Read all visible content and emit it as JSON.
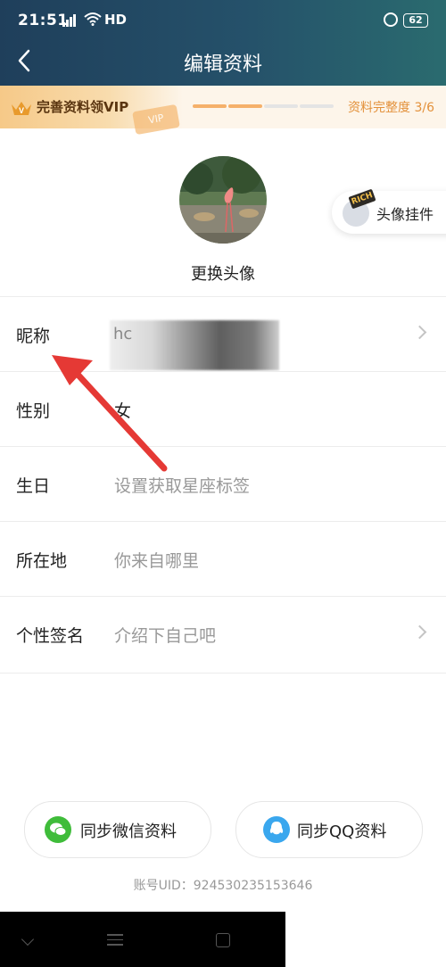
{
  "status_bar": {
    "time": "21:51",
    "network_label": "HD",
    "battery_level": "62"
  },
  "header": {
    "title": "编辑资料"
  },
  "vip_banner": {
    "label": "完善资料领VIP",
    "ticket_text": "VIP",
    "progress_text": "资料完整度 3/6",
    "completed_steps": 3,
    "total_steps": 6,
    "accent_color": "#f5b06a"
  },
  "profile": {
    "change_avatar_label": "更换头像",
    "pendant_label": "头像挂件",
    "pendant_badge": "RICH"
  },
  "fields": {
    "nickname": {
      "label": "昵称",
      "value": "hc"
    },
    "gender": {
      "label": "性别",
      "value": "女"
    },
    "birthday": {
      "label": "生日",
      "placeholder": "设置获取星座标签"
    },
    "location": {
      "label": "所在地",
      "placeholder": "你来自哪里"
    },
    "signature": {
      "label": "个性签名",
      "placeholder": "介绍下自己吧"
    }
  },
  "sync": {
    "wechat_label": "同步微信资料",
    "qq_label": "同步QQ资料",
    "wechat_color": "#3fbc3a",
    "qq_color": "#3aa7ee"
  },
  "account": {
    "uid_text": "账号UID：924530235153646"
  },
  "annotation": {
    "arrow_color": "#e53935"
  }
}
